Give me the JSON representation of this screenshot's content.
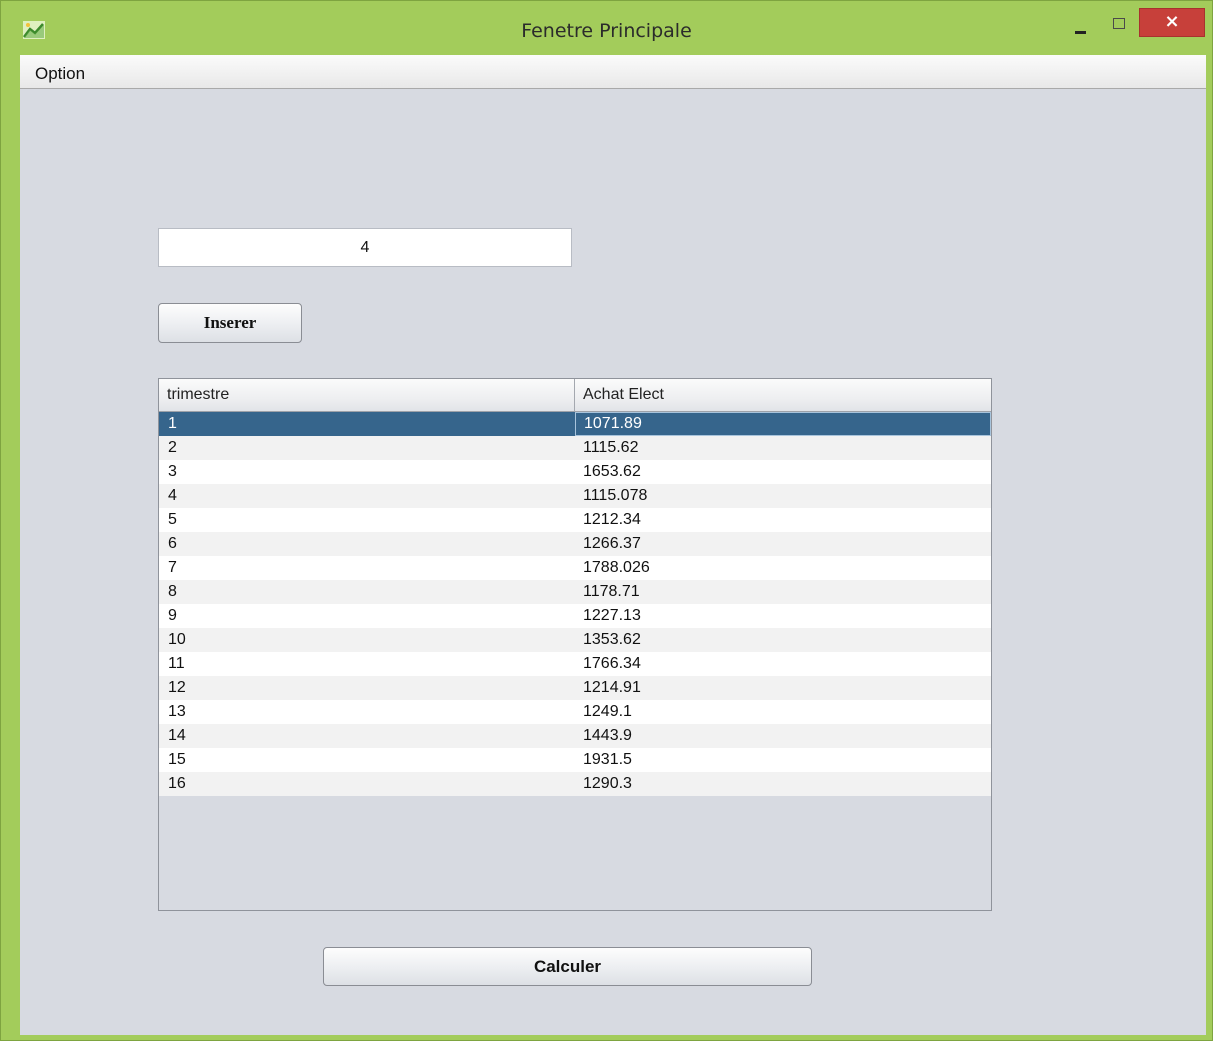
{
  "window": {
    "title": "Fenetre Principale",
    "close_glyph": "×",
    "frame_color": "#a3cc5b",
    "close_color": "#c7403a"
  },
  "menu": {
    "option_label": "Option"
  },
  "input": {
    "value": "4"
  },
  "buttons": {
    "insert_label": "Inserer",
    "calc_label": "Calculer"
  },
  "table": {
    "headers": [
      "trimestre",
      "Achat Elect"
    ],
    "selected_row_color": "#36658c",
    "rows": [
      [
        "1",
        "1071.89"
      ],
      [
        "2",
        "1115.62"
      ],
      [
        "3",
        "1653.62"
      ],
      [
        "4",
        "1115.078"
      ],
      [
        "5",
        "1212.34"
      ],
      [
        "6",
        "1266.37"
      ],
      [
        "7",
        "1788.026"
      ],
      [
        "8",
        "1178.71"
      ],
      [
        "9",
        "1227.13"
      ],
      [
        "10",
        "1353.62"
      ],
      [
        "11",
        "1766.34"
      ],
      [
        "12",
        "1214.91"
      ],
      [
        "13",
        "1249.1"
      ],
      [
        "14",
        "1443.9"
      ],
      [
        "15",
        "1931.5"
      ],
      [
        "16",
        "1290.3"
      ]
    ]
  }
}
